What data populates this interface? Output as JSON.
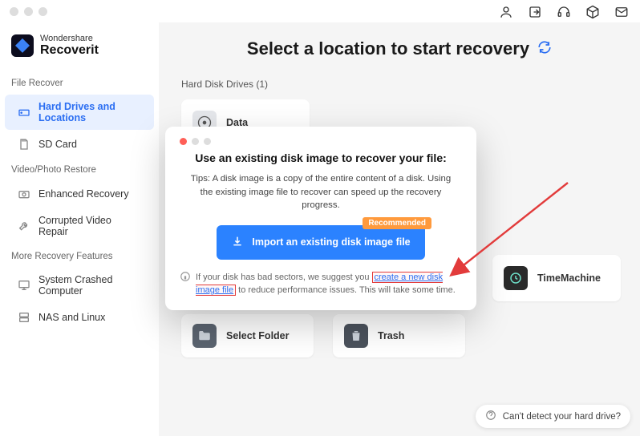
{
  "brand": {
    "top": "Wondershare",
    "name": "Recoverit"
  },
  "topbar_icons": [
    "user-icon",
    "export-icon",
    "headset-icon",
    "cube-icon",
    "mail-icon"
  ],
  "sidebar": {
    "sections": [
      {
        "label": "File Recover",
        "items": [
          {
            "key": "hard-drives",
            "label": "Hard Drives and Locations",
            "active": true,
            "icon": "drive-icon"
          },
          {
            "key": "sd-card",
            "label": "SD Card",
            "active": false,
            "icon": "sd-icon"
          }
        ]
      },
      {
        "label": "Video/Photo Restore",
        "items": [
          {
            "key": "enhanced",
            "label": "Enhanced Recovery",
            "active": false,
            "icon": "camera-icon"
          },
          {
            "key": "corrupted",
            "label": "Corrupted Video Repair",
            "active": false,
            "icon": "wrench-icon"
          }
        ]
      },
      {
        "label": "More Recovery Features",
        "items": [
          {
            "key": "crashed",
            "label": "System Crashed Computer",
            "active": false,
            "icon": "monitor-icon"
          },
          {
            "key": "nas",
            "label": "NAS and Linux",
            "active": false,
            "icon": "server-icon"
          }
        ]
      }
    ]
  },
  "main": {
    "title": "Select a location to start recovery",
    "hdd_label": "Hard Disk Drives (1)",
    "drives": [
      {
        "name": "Data"
      }
    ],
    "timemachine_label": "TimeMachine",
    "quick": {
      "select_folder": "Select Folder",
      "trash": "Trash"
    }
  },
  "modal": {
    "title": "Use an existing disk image to recover your file:",
    "tip": "Tips: A disk image is a copy of the entire content of a disk. Using the existing image file to recover can speed up the recovery progress.",
    "import_label": "Import an existing disk image file",
    "reco_tag": "Recommended",
    "foot_pre": "If your disk has bad sectors, we suggest you ",
    "foot_link": "create a new disk image file",
    "foot_post": " to reduce performance issues. This will take some time."
  },
  "help_pill": "Can't detect your hard drive?"
}
